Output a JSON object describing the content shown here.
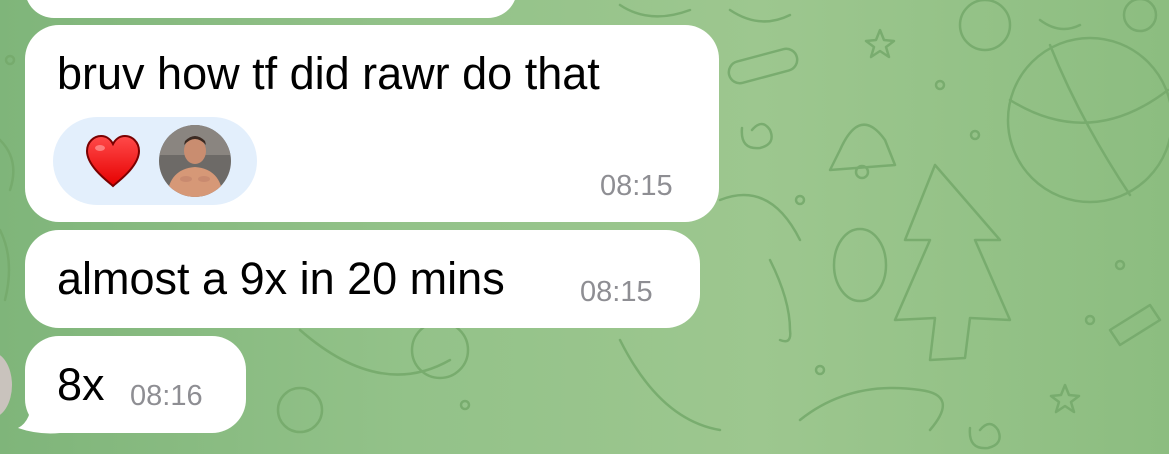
{
  "chat": {
    "messages": [
      {
        "text": "bruv how tf did rawr do that",
        "time": "08:15",
        "reactions": [
          {
            "icon": "red-heart-icon"
          },
          {
            "icon": "user-avatar"
          }
        ]
      },
      {
        "text": "almost a 9x in 20 mins",
        "time": "08:15"
      },
      {
        "text": "8x",
        "time": "08:16"
      }
    ]
  },
  "colors": {
    "bubble": "#ffffff",
    "reaction_pill": "#e3effc",
    "timestamp": "#8e8e93",
    "heart": "#ff1a1a",
    "wallpaper": "#93c289"
  }
}
